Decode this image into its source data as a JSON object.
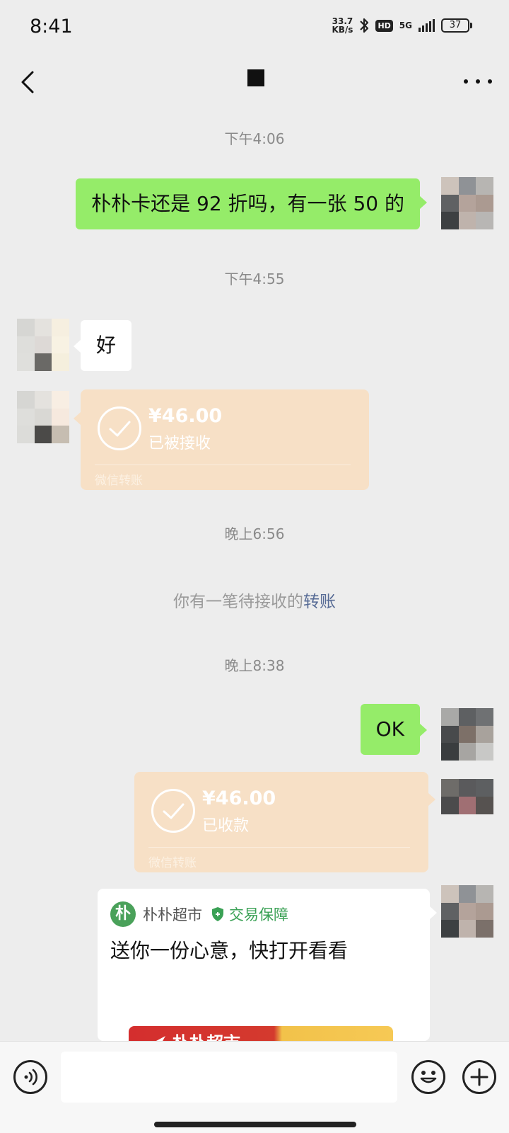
{
  "status_bar": {
    "time": "8:41",
    "net_speed_value": "33.7",
    "net_speed_unit": "KB/s",
    "hd_label": "HD",
    "network_label": "5G",
    "battery": "37",
    "icons": [
      "bluetooth-icon",
      "signal-icon",
      "battery-icon"
    ]
  },
  "header": {
    "back_icon": "chevron-left-icon",
    "more_icon": "more-dots-icon"
  },
  "messages": {
    "ts1": "下午4:06",
    "msg1": "朴朴卡还是 92 折吗，有一张 50 的",
    "ts2": "下午4:55",
    "msg2": "好",
    "transfer1": {
      "amount": "¥46.00",
      "status": "已被接收",
      "label": "微信转账"
    },
    "ts3": "晚上6:56",
    "sys_msg_prefix": "你有一笔待接收的",
    "sys_msg_link": "转账",
    "ts4": "晚上8:38",
    "msg3": "OK",
    "transfer2": {
      "amount": "¥46.00",
      "status": "已收款",
      "label": "微信转账"
    },
    "gift": {
      "logo_char": "朴",
      "store": "朴朴超市",
      "guarantee": "交易保障",
      "text": "送你一份心意，快打开看看",
      "banner_text": "朴朴超市"
    }
  },
  "input_bar": {
    "placeholder": "",
    "voice_icon": "voice-icon",
    "emoji_icon": "emoji-icon",
    "plus_icon": "plus-icon"
  },
  "colors": {
    "background": "#ededed",
    "sent_bubble": "#95ec69",
    "received_bubble": "#ffffff",
    "transfer_card": "#f7e0c6",
    "link": "#576b95",
    "guarantee_green": "#3aa155"
  }
}
